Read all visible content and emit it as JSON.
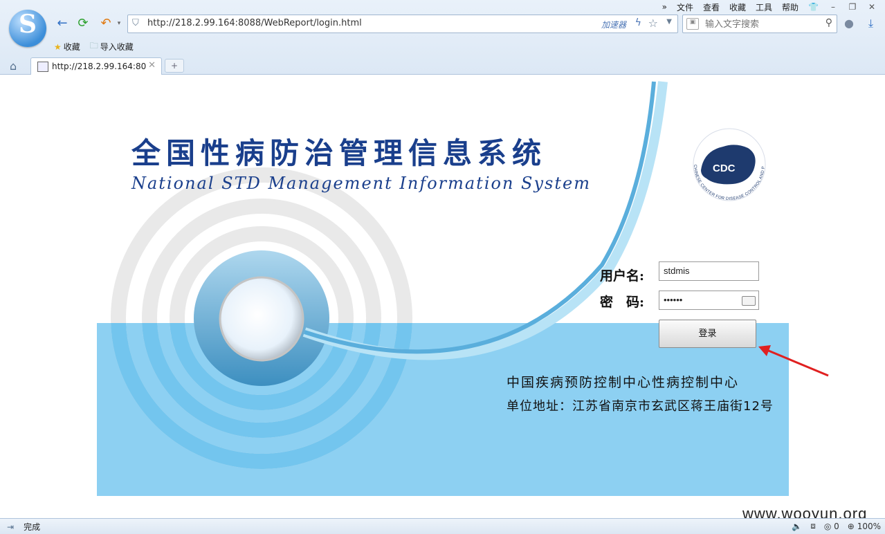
{
  "menubar": {
    "items": [
      "文件",
      "查看",
      "收藏",
      "工具",
      "帮助"
    ]
  },
  "address": {
    "url": "http://218.2.99.164:8088/WebReport/login.html",
    "accelerator": "加速器"
  },
  "search": {
    "placeholder": "输入文字搜索"
  },
  "bookmarks": {
    "favorites": "收藏",
    "import": "导入收藏"
  },
  "tab": {
    "title": "http://218.2.99.164:80"
  },
  "page": {
    "title_cn": "全国性病防治管理信息系统",
    "title_en": "National STD Management Information System",
    "username_label": "用户名:",
    "password_label": "密　码:",
    "username_value": "stdmis",
    "password_mask": "••••••",
    "login_button": "登录",
    "org": "中国疾病预防控制中心性病控制中心",
    "address": "单位地址：江苏省南京市玄武区蒋王庙街12号",
    "logo_text": "CDC",
    "logo_ring_text": "CHINESE CENTER FOR DISEASE CONTROL AND PREVENTION"
  },
  "watermark": "www.wooyun.org",
  "status": {
    "text": "完成",
    "downloads": "0",
    "zoom": "100%"
  },
  "colors": {
    "title": "#1a3f8c",
    "band": "#8dd0f2",
    "arrow": "#e02020"
  }
}
